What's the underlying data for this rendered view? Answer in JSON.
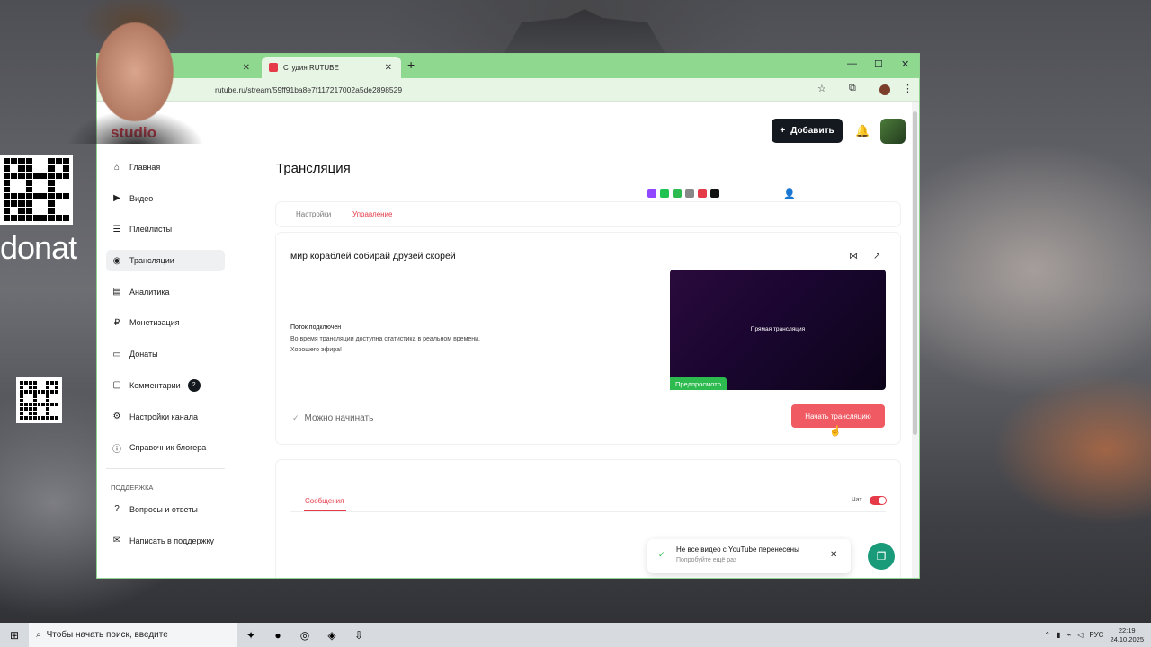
{
  "overlay": {
    "donat_label": "donat"
  },
  "browser": {
    "tabs": [
      {
        "label": ""
      },
      {
        "label": "Студия RUTUBE",
        "active": true
      }
    ],
    "url": "rutube.ru/stream/59ff91ba8e7f117217002a5de2898529"
  },
  "header": {
    "logo_prefix": "",
    "logo_text": "studio",
    "add_button": "Добавить"
  },
  "sidebar": {
    "items": [
      {
        "label": "Главная",
        "icon": "home-icon"
      },
      {
        "label": "Видео",
        "icon": "video-icon"
      },
      {
        "label": "Плейлисты",
        "icon": "playlist-icon"
      },
      {
        "label": "Трансляции",
        "icon": "broadcast-icon",
        "active": true
      },
      {
        "label": "Аналитика",
        "icon": "analytics-icon"
      },
      {
        "label": "Монетизация",
        "icon": "money-icon"
      },
      {
        "label": "Донаты",
        "icon": "donate-icon"
      },
      {
        "label": "Комментарии",
        "icon": "comments-icon",
        "badge": "2"
      },
      {
        "label": "Настройки канала",
        "icon": "settings-icon"
      },
      {
        "label": "Справочник блогера",
        "icon": "info-icon"
      }
    ],
    "support_heading": "ПОДДЕРЖКА",
    "support_items": [
      {
        "label": "Вопросы и ответы",
        "icon": "help-icon"
      },
      {
        "label": "Написать в поддержку",
        "icon": "mail-icon"
      }
    ]
  },
  "main": {
    "title": "Трансляция",
    "tabs": [
      {
        "label": "Настройки"
      },
      {
        "label": "Управление",
        "active": true
      }
    ],
    "stream": {
      "name": "мир кораблей собирай друзей скорей",
      "status_head": "Поток подключен",
      "status_line1": "Во время трансляции доступна статистика в реальном времени.",
      "status_line2": "Хорошего эфира!",
      "preview_text": "Прямая трансляция",
      "preview_badge": "Предпросмотр",
      "ready_text": "Можно начинать",
      "start_button": "Начать трансляцию"
    },
    "chat": {
      "tab_label": "Сообщения",
      "toggle_label": "Чат",
      "toggle_on": true
    },
    "toast": {
      "title": "Не все видео с YouTube перенесены",
      "subtitle": "Попробуйте ещё раз"
    }
  },
  "taskbar": {
    "search_placeholder": "Чтобы начать поиск, введите",
    "lang": "РУС",
    "time": "22:19",
    "date": "24.10.2025"
  },
  "colors": {
    "accent": "#e53a48",
    "tab_green": "#8ed88f",
    "preview_badge": "#2dbb4f",
    "help_button": "#199a78"
  }
}
